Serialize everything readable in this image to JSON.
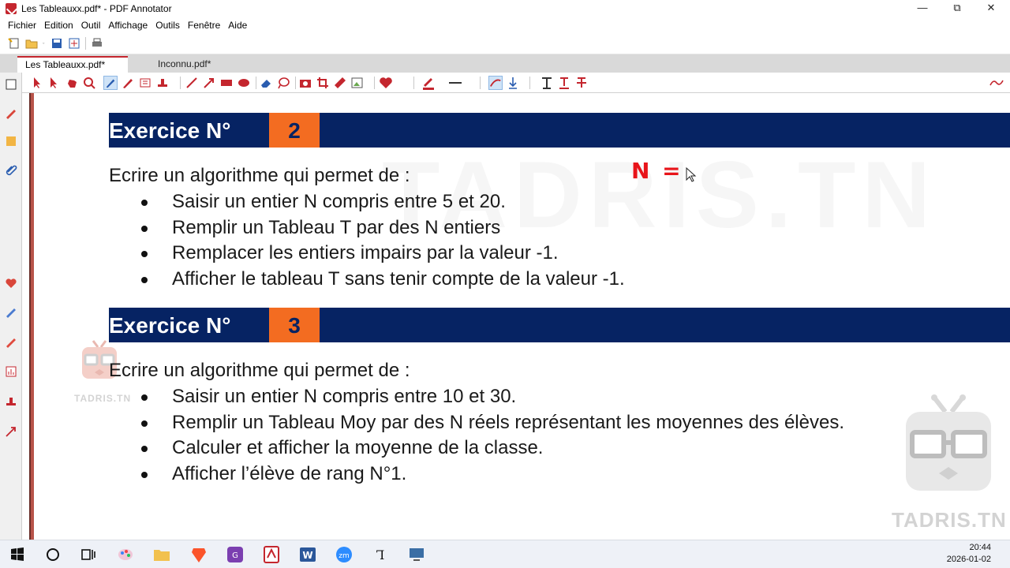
{
  "window": {
    "title": "Les Tableauxx.pdf* - PDF Annotator",
    "controls": {
      "minimize": "—",
      "restore": "⧉",
      "close": "✕"
    }
  },
  "menu": [
    "Fichier",
    "Edition",
    "Outil",
    "Affichage",
    "Outils",
    "Fenêtre",
    "Aide"
  ],
  "quick_toolbar": [
    "new-document-icon",
    "open-folder-icon",
    "save-icon",
    "save-all-icon",
    "print-icon"
  ],
  "tabs": [
    {
      "label": "Les Tableauxx.pdf*",
      "active": true
    },
    {
      "label": "Inconnu.pdf*",
      "active": false
    }
  ],
  "annotation_toolbar": [
    "select-arrow-icon",
    "select-area-icon",
    "hand-icon",
    "zoom-icon",
    "pen-icon",
    "marker-icon",
    "text-box-icon",
    "stamp-icon",
    "line-icon",
    "arrow-icon",
    "rectangle-icon",
    "ellipse-icon",
    "eraser-icon",
    "lasso-icon",
    "camera-icon",
    "crop-icon",
    "ruler-icon",
    "image-icon",
    "heart-icon",
    "color-icon",
    "line-style-icon",
    "curve-icon",
    "scroll-down-icon",
    "text-T-icon",
    "underline-icon",
    "strikethrough-icon"
  ],
  "accent_color": "#c4262e",
  "document": {
    "exercises": [
      {
        "heading": "Exercice N°",
        "number": "2",
        "intro": "Ecrire un algorithme qui permet de :",
        "items": [
          "Saisir un entier N compris entre 5 et 20.",
          "Remplir un Tableau T par des N entiers",
          "Remplacer les entiers impairs par la valeur -1.",
          "Afficher le tableau T sans tenir compte de la valeur -1."
        ]
      },
      {
        "heading": "Exercice N°",
        "number": "3",
        "intro": "Ecrire un algorithme qui permet de :",
        "items": [
          "Saisir un entier N compris entre 10 et 30.",
          "Remplir un Tableau Moy par des N réels représentant les moyennes des élèves.",
          "Calculer et afficher la moyenne de la classe.",
          "Afficher l’élève de rang N°1."
        ]
      }
    ],
    "handwritten_note": "N =",
    "watermark_small": "TADRIS.TN",
    "watermark_large": "TADRIS.TN",
    "watermark_center": "TADRIS.TN",
    "band_color": "#062363",
    "number_color": "#f36c21",
    "ink_color": "#e8141a"
  },
  "taskbar": {
    "apps": [
      "windows-start-icon",
      "search-circle-icon",
      "task-view-icon",
      "paint-icon",
      "file-explorer-icon",
      "brave-browser-icon",
      "pdf-gear-icon",
      "pdf-annotator-icon",
      "word-icon",
      "zoom-icon",
      "typora-icon",
      "remote-desktop-icon"
    ],
    "time": "20:44",
    "date": "2026-01-02"
  }
}
